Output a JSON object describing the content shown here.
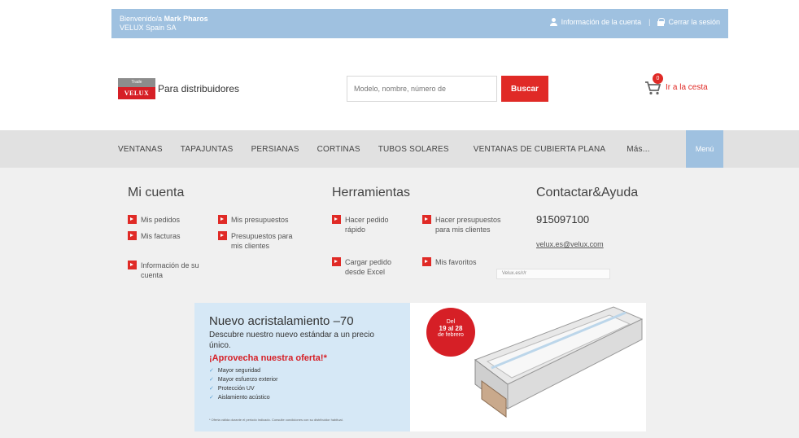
{
  "topbar": {
    "welcome_prefix": "Bienvenido/a",
    "welcome_name": "Mark Pharos",
    "company": "VELUX Spain SA",
    "account_info": "Información de la cuenta",
    "logout": "Cerrar la sesión"
  },
  "header": {
    "logo_top": "Trade",
    "logo_brand": "VELUX",
    "logo_tagline": "Para distribuidores",
    "search_placeholder": "Modelo, nombre, número de",
    "search_button": "Buscar",
    "cart_count": "0",
    "cart_link": "Ir a la cesta"
  },
  "nav": {
    "items": [
      "VENTANAS",
      "TAPAJUNTAS",
      "PERSIANAS",
      "CORTINAS",
      "TUBOS SOLARES",
      "VENTANAS DE CUBIERTA PLANA",
      "Más..."
    ],
    "more": "Menú"
  },
  "mega": {
    "account_title": "Mi cuenta",
    "account_links": [
      "Mis pedidos",
      "Mis presupuestos",
      "Mis facturas",
      "Presupuestos para mis clientes",
      "Información de su cuenta"
    ],
    "tools_title": "Herramientas",
    "tools_links": [
      "Hacer pedido rápido",
      "Hacer presupuestos para mis clientes",
      "Cargar pedido desde Excel",
      "Mis favoritos"
    ],
    "contact_title": "Contactar&Ayuda",
    "phone": "915097100",
    "email": "velux.es@velux.com",
    "tooltip": "Velux.es/r/r"
  },
  "banner": {
    "title": "Nuevo acristalamiento –70",
    "subtitle": "Descubre nuestro nuevo estándar a un precio único.",
    "offer": "¡Aprovecha nuestra oferta!*",
    "bullets": [
      "Mayor seguridad",
      "Mayor esfuerzo exterior",
      "Protección UV",
      "Aislamiento acústico"
    ],
    "badge_line1": "Del",
    "badge_line2": "19 al 28",
    "badge_line3": "de febrero",
    "fine_print": "* Oferta válida durante el periodo indicado. Consulte condiciones con su distribuidor habitual."
  },
  "colors": {
    "topbar": "#9fc1e0",
    "accent_red": "#e02a26",
    "nav_bg": "#e1e1e1",
    "mega_bg": "#f0f0f0"
  }
}
